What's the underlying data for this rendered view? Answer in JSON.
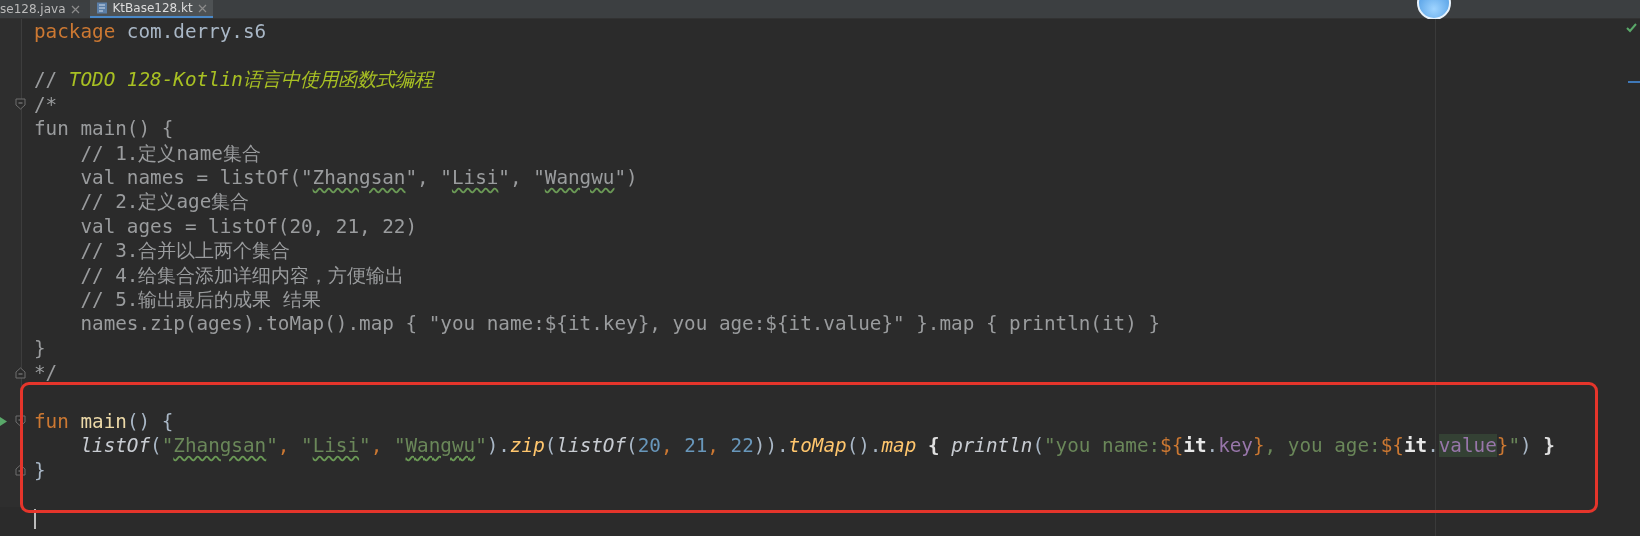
{
  "tabs": [
    {
      "label": "se128.java",
      "selected": false,
      "kind": "java"
    },
    {
      "label": "KtBase128.kt",
      "selected": true,
      "kind": "kotlin"
    }
  ],
  "editor": {
    "sections": [
      {
        "highlighted": false,
        "lines": [
          {
            "kind": "code",
            "tokens": [
              {
                "text": "package",
                "kind": "keyword"
              },
              {
                "text": " com.derry.s6",
                "kind": "plain"
              }
            ]
          },
          {
            "kind": "blank"
          },
          {
            "kind": "code",
            "tokens": [
              {
                "text": "// ",
                "kind": "comment"
              },
              {
                "text": "TODO 128-Kotlin语言中使用函数式编程",
                "kind": "todo"
              }
            ]
          },
          {
            "kind": "fold-start",
            "tokens": [
              {
                "text": "/*",
                "kind": "comment"
              }
            ]
          },
          {
            "kind": "code",
            "tokens": [
              {
                "text": "fun main() {",
                "kind": "comment"
              }
            ]
          },
          {
            "kind": "code",
            "tokens": [
              {
                "text": "    // 1.定义name集合",
                "kind": "comment"
              }
            ]
          },
          {
            "kind": "code",
            "tokens": [
              {
                "text": "    val names = listOf(\"",
                "kind": "comment"
              },
              {
                "text": "Zhangsan",
                "kind": "comment-typo"
              },
              {
                "text": "\", \"",
                "kind": "comment"
              },
              {
                "text": "Lisi",
                "kind": "comment-typo"
              },
              {
                "text": "\", \"",
                "kind": "comment"
              },
              {
                "text": "Wangwu",
                "kind": "comment-typo"
              },
              {
                "text": "\")",
                "kind": "comment"
              }
            ]
          },
          {
            "kind": "code",
            "tokens": [
              {
                "text": "    // 2.定义age集合",
                "kind": "comment"
              }
            ]
          },
          {
            "kind": "code",
            "tokens": [
              {
                "text": "    val ages = listOf(20, 21, 22)",
                "kind": "comment"
              }
            ]
          },
          {
            "kind": "code",
            "tokens": [
              {
                "text": "    // 3.合并以上两个集合",
                "kind": "comment"
              }
            ]
          },
          {
            "kind": "code",
            "tokens": [
              {
                "text": "    // 4.给集合添加详细内容，方便输出",
                "kind": "comment"
              }
            ]
          },
          {
            "kind": "code",
            "tokens": [
              {
                "text": "    // 5.输出最后的成果 结果",
                "kind": "comment"
              }
            ]
          },
          {
            "kind": "code",
            "tokens": [
              {
                "text": "    names.zip(ages).toMap().map { \"you name:${it.key}, you age:${it.value}\" }.map { println(it) }",
                "kind": "comment"
              }
            ]
          },
          {
            "kind": "code",
            "tokens": [
              {
                "text": "}",
                "kind": "comment"
              }
            ]
          },
          {
            "kind": "fold-end",
            "tokens": [
              {
                "text": "*/",
                "kind": "comment"
              }
            ]
          }
        ]
      },
      {
        "highlighted": true,
        "lines": [
          {
            "kind": "blank"
          },
          {
            "kind": "fold-start",
            "run": true,
            "tokens": [
              {
                "text": "fun",
                "kind": "keyword"
              },
              {
                "text": " main",
                "kind": "declaration"
              },
              {
                "text": "() {",
                "kind": "plain"
              }
            ]
          },
          {
            "kind": "code",
            "tokens": [
              {
                "text": "    listOf",
                "kind": "call"
              },
              {
                "text": "(",
                "kind": "plain"
              },
              {
                "text": "\"",
                "kind": "string"
              },
              {
                "text": "Zhangsan",
                "kind": "string-typo"
              },
              {
                "text": "\"",
                "kind": "string"
              },
              {
                "text": ", ",
                "kind": "punct"
              },
              {
                "text": "\"",
                "kind": "string"
              },
              {
                "text": "Lisi",
                "kind": "string-typo"
              },
              {
                "text": "\"",
                "kind": "string"
              },
              {
                "text": ", ",
                "kind": "punct"
              },
              {
                "text": "\"",
                "kind": "string"
              },
              {
                "text": "Wangwu",
                "kind": "string-typo"
              },
              {
                "text": "\"",
                "kind": "string"
              },
              {
                "text": ").",
                "kind": "plain"
              },
              {
                "text": "zip",
                "kind": "ext-call"
              },
              {
                "text": "(",
                "kind": "plain"
              },
              {
                "text": "listOf",
                "kind": "call"
              },
              {
                "text": "(",
                "kind": "plain"
              },
              {
                "text": "20",
                "kind": "number"
              },
              {
                "text": ", ",
                "kind": "punct"
              },
              {
                "text": "21",
                "kind": "number"
              },
              {
                "text": ", ",
                "kind": "punct"
              },
              {
                "text": "22",
                "kind": "number"
              },
              {
                "text": ")).",
                "kind": "plain"
              },
              {
                "text": "toMap",
                "kind": "ext-call"
              },
              {
                "text": "().",
                "kind": "plain"
              },
              {
                "text": "map",
                "kind": "ext-call"
              },
              {
                "text": " { ",
                "kind": "brace"
              },
              {
                "text": "println",
                "kind": "call"
              },
              {
                "text": "(",
                "kind": "plain"
              },
              {
                "text": "\"you name:",
                "kind": "string"
              },
              {
                "text": "${",
                "kind": "escape"
              },
              {
                "text": "it",
                "kind": "it"
              },
              {
                "text": ".",
                "kind": "plain"
              },
              {
                "text": "key",
                "kind": "property"
              },
              {
                "text": "}",
                "kind": "escape"
              },
              {
                "text": ", you age:",
                "kind": "string"
              },
              {
                "text": "${",
                "kind": "escape"
              },
              {
                "text": "it",
                "kind": "it"
              },
              {
                "text": ".",
                "kind": "plain"
              },
              {
                "text": "value",
                "kind": "property-marked"
              },
              {
                "text": "}",
                "kind": "escape"
              },
              {
                "text": "\"",
                "kind": "string"
              },
              {
                "text": ") ",
                "kind": "plain"
              },
              {
                "text": "}",
                "kind": "brace"
              }
            ]
          },
          {
            "kind": "fold-end",
            "tokens": [
              {
                "text": "}",
                "kind": "plain"
              }
            ]
          },
          {
            "kind": "blank"
          }
        ]
      }
    ],
    "cursor": {
      "visible": true
    }
  },
  "status": {
    "inspection_ok": true
  }
}
